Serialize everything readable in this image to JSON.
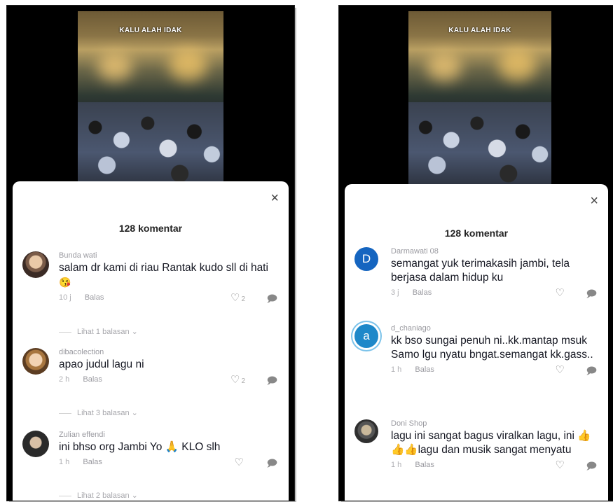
{
  "left_panel": {
    "video_caption": "KALU ALAH IDAK",
    "close_label": "×",
    "comment_count": "128 komentar",
    "comments": [
      {
        "user": "Bunda wati",
        "text": "salam dr kami di riau Rantak kudo sll di hati",
        "emoji": "😘",
        "time": "10 j",
        "reply": "Balas",
        "likes": "2",
        "view_replies": "Lihat 1 balasan ⌄"
      },
      {
        "user": "dibacolection",
        "text": "apao judul lagu ni",
        "time": "2 h",
        "reply": "Balas",
        "likes": "2",
        "view_replies": "Lihat 3 balasan ⌄"
      },
      {
        "user": "Zulian effendi",
        "text": "ini bhso org Jambi Yo 🙏 KLO slh",
        "time": "1 h",
        "reply": "Balas",
        "likes": "",
        "view_replies": "Lihat 2 balasan ⌄"
      }
    ]
  },
  "right_panel": {
    "video_caption": "KALU ALAH IDAK",
    "close_label": "×",
    "comment_count": "128 komentar",
    "comments": [
      {
        "user": "Darmawati 08",
        "avatar_letter": "D",
        "avatar_color": "#1565c0",
        "text": "semangat yuk terimakasih jambi, tela berjasa dalam hidup ku",
        "time": "3 j",
        "reply": "Balas"
      },
      {
        "user": "d_chaniago",
        "avatar_letter": "a",
        "avatar_color": "#1e88c9",
        "text": "kk bso sungai penuh ni..kk.mantap msuk Samo lgu nyatu bngat.semangat kk.gass..",
        "time": "1 h",
        "reply": "Balas"
      },
      {
        "user": "Doni Shop",
        "text": "lagu ini sangat bagus viralkan lagu, ini 👍👍👍lagu dan musik sangat menyatu",
        "time": "1 h",
        "reply": "Balas"
      }
    ]
  }
}
